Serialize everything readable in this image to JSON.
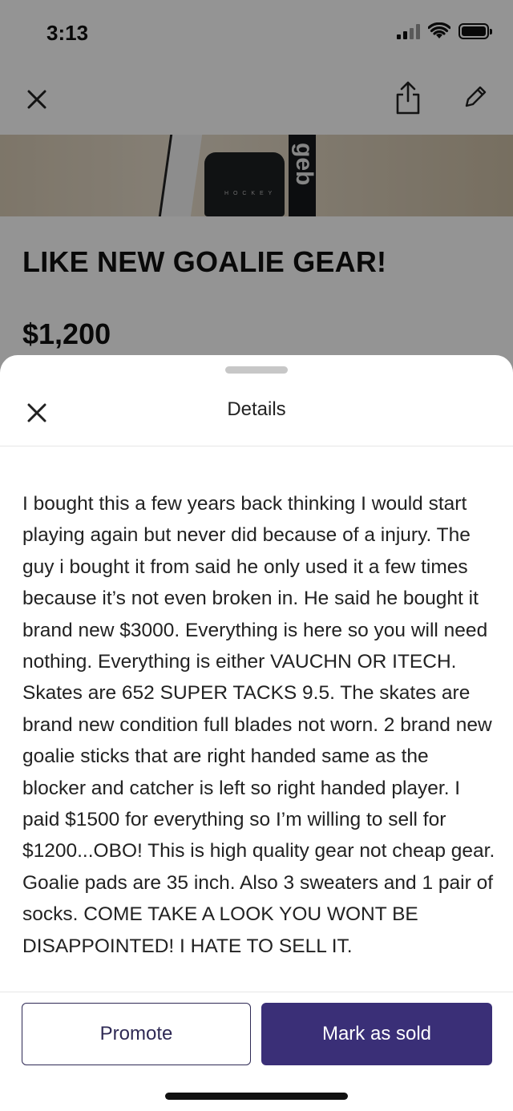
{
  "status_bar": {
    "time": "3:13"
  },
  "hero": {
    "bag_text": "H O C K E Y",
    "stick_text": "geb"
  },
  "listing": {
    "title": "LIKE NEW GOALIE GEAR!",
    "price": "$1,200"
  },
  "sheet": {
    "title": "Details",
    "description": "I bought this a few years back thinking I would start playing again but never did because of a injury. The guy i bought it from said he only used it a few times because it’s not even broken in. He said he bought it brand new $3000. Everything is here so you will need nothing. Everything is either VAUCHN OR ITECH. Skates are 652 SUPER TACKS 9.5. The skates are brand new condition full blades not worn. 2 brand new goalie sticks that are right handed same as the blocker and catcher is left so right handed player. I paid $1500 for everything so I’m willing to sell for $1200...OBO! This is high quality gear not cheap gear. Goalie pads are 35 inch. Also 3 sweaters and 1 pair of socks. COME TAKE A LOOK YOU WONT BE DISAPPOINTED! I HATE TO SELL IT.",
    "promote_label": "Promote",
    "mark_sold_label": "Mark as sold"
  },
  "icons": {
    "close": "close-icon",
    "share": "share-icon",
    "edit": "pencil-icon"
  },
  "colors": {
    "primary": "#3a2f77",
    "outline": "#2f2a55"
  }
}
